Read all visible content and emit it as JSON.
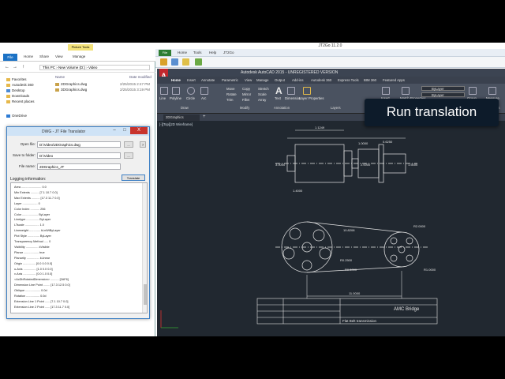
{
  "explorer": {
    "context_tab": "Picture Tools",
    "ribbon": [
      "File",
      "Home",
      "Share",
      "View",
      "Manage"
    ],
    "address": "This PC  ›  New Volume (D:)  ›  Video",
    "nav": [
      "Favorites",
      "Autodesk 360",
      "Desktop",
      "Downloads",
      "Recent places",
      "OneDrive"
    ],
    "headers": {
      "name": "Name",
      "date": "Date modified"
    },
    "files": [
      {
        "name": "2DGraphics.dwg",
        "date": "2/25/2015 2:47 PM"
      },
      {
        "name": "3DGraphics.dwg",
        "date": "2/25/2015 3:19 PM"
      }
    ]
  },
  "translator": {
    "title": "DWG - JT File Translator",
    "open_label": "Open file:",
    "open_value": "D:\\Video\\2DGraphics.dwg",
    "save_label": "Save to folder:",
    "save_value": "D:\\Video",
    "name_label": "File name:",
    "name_value": "2DGraphics_JT",
    "browse": "...",
    "log_label": "Logging information:",
    "translate_button": "Translate",
    "close": "X",
    "min": "–",
    "max": "□",
    "log": [
      "Area ........................ 0.0",
      "Min Extents .......... [7.1 10.7 0.0]",
      "Max Extents .......... [17.3 11.7 0.0]",
      "Layer .................. 0",
      "Color Index ........... 256",
      "Color ................... ByLayer",
      "Linetype ............... ByLayer",
      "LTscale ................. 1.0",
      "Lineweight ............. kLnWtByLayer",
      "Plot Style .............. ByLayer",
      "Transparency Method ..... 0",
      "Visibility ............... kVisible",
      "Planar .................. true",
      "Planarity ............... kLinear",
      "  Origin ............... [0.0 0.0 0.0]",
      "  u-Axis ............... [1.0 0.0 0.0]",
      "  v-Axis ............... [0.0 1.0 0.0]",
      "<AcDbRotatedDimension> .......... [2AF6]",
      "Dimension Line Point ........ [17.3 12.5 0.0]",
      "Oblique .................. 0.0d",
      "Rotation ................ 0.0d",
      "Extension Line 1 Point ...... [7.1 10.7 0.0]",
      "Extension Line 2 Point ...... [17.3 11.7 0.0]"
    ]
  },
  "jt2go": {
    "title": "JT2Go 11.2.0",
    "file": "File",
    "tabs": [
      "Home",
      "Tools",
      "Help",
      "JT2Go"
    ]
  },
  "autocad": {
    "title": "Autodesk AutoCAD 2015 - UNREGISTERED VERSION",
    "logo": "A",
    "tabs": [
      "Home",
      "Insert",
      "Annotate",
      "Parametric",
      "View",
      "Manage",
      "Output",
      "Add-ins",
      "Autodesk 360",
      "Express Tools",
      "BIM 360",
      "Featured Apps"
    ],
    "tools": {
      "line": "Line",
      "polyline": "Polyline",
      "circle": "Circle",
      "arc": "Arc",
      "move": "Move",
      "rotate": "Rotate",
      "trim": "Trim",
      "copy": "Copy",
      "mirror": "Mirror",
      "fillet": "Fillet",
      "stretch": "Stretch",
      "scale": "Scale",
      "array": "Array",
      "text": "Text",
      "dimension": "Dimension",
      "layer_props": "Layer Properties",
      "insert": "Insert",
      "match": "Match Properties",
      "group": "Group",
      "utilities": "Utilities",
      "measure": "Measure",
      "bylayer": "ByLayer"
    },
    "panels": [
      "Draw",
      "Modify",
      "Annotation",
      "Layers",
      "Block",
      "Properties",
      "Groups",
      "Utilities"
    ],
    "doc_tab": "2DGraphics",
    "viewport_label": "[-][Top][2D Wireframe]"
  },
  "drawing": {
    "dims": {
      "shaft_length": "10.8208",
      "d1": "1.1249",
      "d2": "1.0000",
      "d3": "0.6250",
      "h1": "3.0000",
      "h2": "2.0000",
      "h3": "1.5000",
      "small_w": "1.4000",
      "r_big": "R2.0000",
      "r_small": "R1.0000",
      "r_hole": "R0.5000",
      "r_hole2": "R0.2500",
      "centers": "11.0000"
    },
    "titleblock": {
      "company": "AMC Bridge",
      "drawing_title": "Flat Belt transmission"
    }
  },
  "overlay": {
    "text": "Run translation"
  }
}
